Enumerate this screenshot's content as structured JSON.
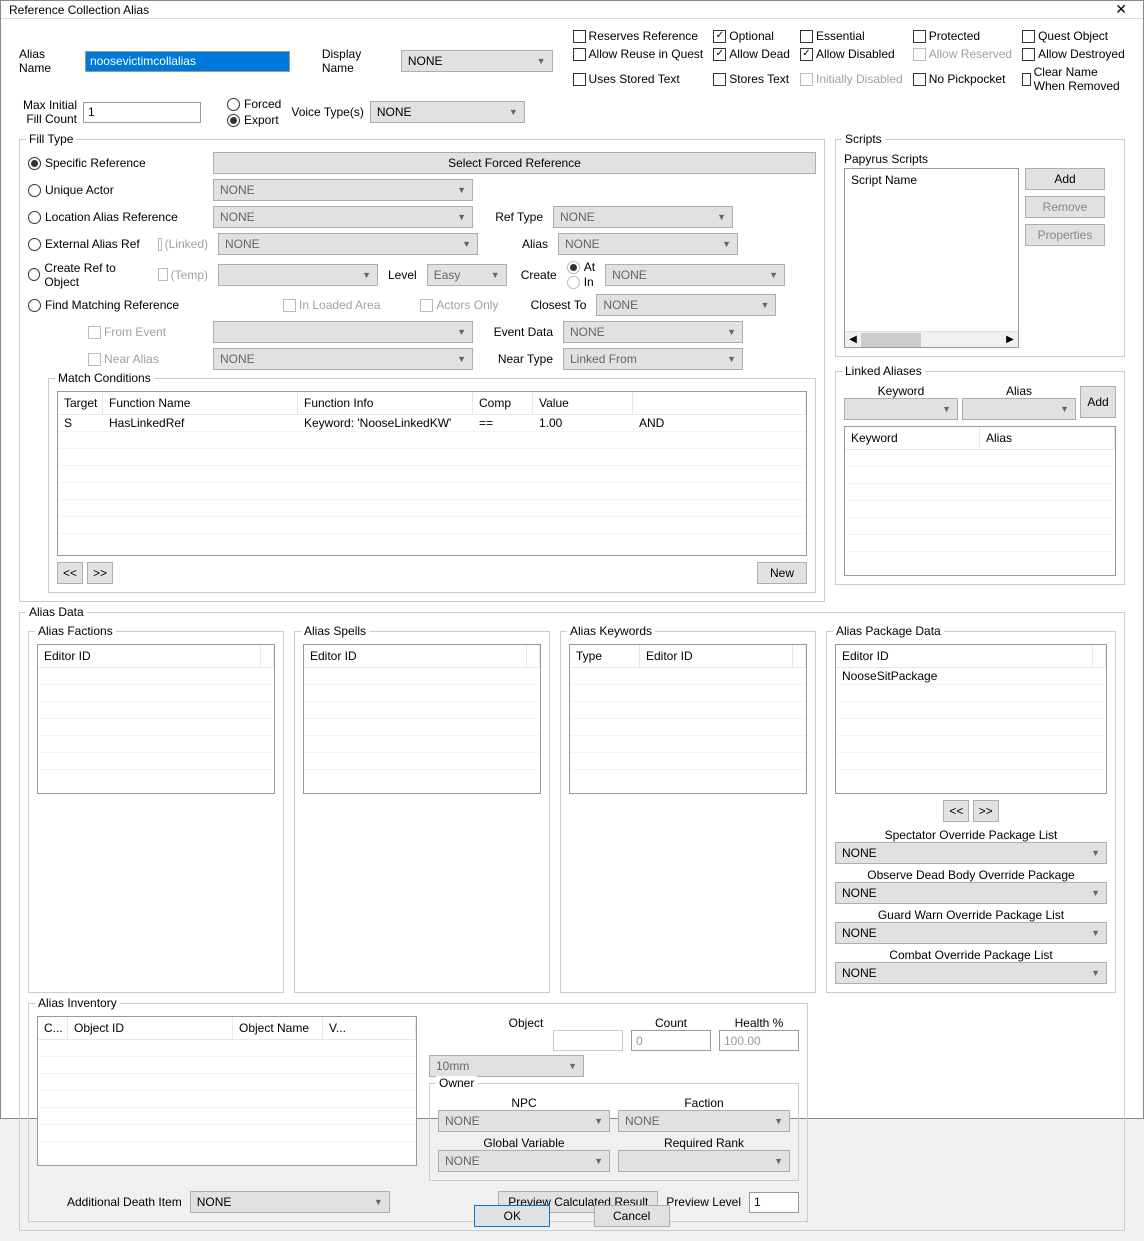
{
  "window": {
    "title": "Reference Collection Alias"
  },
  "alias_name_label": "Alias Name",
  "alias_name_value": "noosevictimcollalias",
  "display_name_label": "Display Name",
  "display_name_value": "NONE",
  "max_initial_label": "Max Initial\nFill Count",
  "max_initial_value": "1",
  "forced_label": "Forced",
  "export_label": "Export",
  "voice_types_label": "Voice Type(s)",
  "voice_types_value": "NONE",
  "flags": {
    "reserves_reference": "Reserves Reference",
    "optional": "Optional",
    "essential": "Essential",
    "protected": "Protected",
    "quest_object": "Quest Object",
    "allow_reuse": "Allow Reuse in Quest",
    "allow_dead": "Allow Dead",
    "allow_disabled": "Allow Disabled",
    "allow_reserved": "Allow Reserved",
    "allow_destroyed": "Allow Destroyed",
    "uses_stored_text": "Uses Stored Text",
    "stores_text": "Stores Text",
    "initially_disabled": "Initially Disabled",
    "no_pickpocket": "No Pickpocket",
    "clear_name": "Clear Name When Removed"
  },
  "fill_type": {
    "legend": "Fill Type",
    "specific_reference": "Specific Reference",
    "select_forced_btn": "Select Forced Reference",
    "unique_actor": "Unique Actor",
    "none": "NONE",
    "location_alias_ref": "Location Alias Reference",
    "ref_type_label": "Ref Type",
    "external_alias_ref": "External Alias Ref",
    "linked_label": "(Linked)",
    "alias_label": "Alias",
    "create_ref": "Create Ref to Object",
    "temp_label": "(Temp)",
    "level_label": "Level",
    "level_value": "Easy",
    "create_label": "Create",
    "create_at": "At",
    "create_in": "In",
    "find_matching": "Find Matching Reference",
    "in_loaded_area": "In Loaded Area",
    "actors_only": "Actors Only",
    "closest_to": "Closest To",
    "from_event": "From Event",
    "event_data": "Event Data",
    "near_alias": "Near Alias",
    "near_type": "Near Type",
    "near_type_value": "Linked From"
  },
  "match_conditions": {
    "legend": "Match Conditions",
    "headers": {
      "target": "Target",
      "function_name": "Function Name",
      "function_info": "Function Info",
      "comp": "Comp",
      "value": "Value",
      "logic": ""
    },
    "rows": [
      {
        "target": "S",
        "function_name": "HasLinkedRef",
        "function_info": "Keyword: 'NooseLinkedKW'",
        "comp": "==",
        "value": "1.00",
        "logic": "AND"
      }
    ],
    "prev": "<<",
    "next": ">>",
    "new": "New"
  },
  "scripts": {
    "legend": "Scripts",
    "papyrus": "Papyrus Scripts",
    "header": "Script Name",
    "add": "Add",
    "remove": "Remove",
    "properties": "Properties"
  },
  "linked_aliases": {
    "legend": "Linked Aliases",
    "keyword": "Keyword",
    "alias": "Alias",
    "add": "Add"
  },
  "alias_data": {
    "legend": "Alias Data",
    "factions": {
      "legend": "Alias Factions",
      "header": "Editor ID"
    },
    "spells": {
      "legend": "Alias Spells",
      "header": "Editor ID"
    },
    "keywords": {
      "legend": "Alias Keywords",
      "type": "Type",
      "editor_id": "Editor ID"
    }
  },
  "package_data": {
    "legend": "Alias Package Data",
    "header": "Editor ID",
    "row1": "NooseSitPackage",
    "prev": "<<",
    "next": ">>",
    "spectator": "Spectator Override Package List",
    "observe": "Observe Dead Body Override Package",
    "guard": "Guard Warn Override Package List",
    "combat": "Combat Override Package List",
    "none": "NONE"
  },
  "inventory": {
    "legend": "Alias Inventory",
    "c": "C...",
    "object_id": "Object ID",
    "object_name": "Object Name",
    "v": "V...",
    "object_label": "Object",
    "combo_value": "10mm",
    "count_label": "Count",
    "count_value": "0",
    "health_label": "Health %",
    "health_value": "100.00",
    "owner_legend": "Owner",
    "npc_label": "NPC",
    "faction_label": "Faction",
    "global_var": "Global Variable",
    "required_rank": "Required Rank",
    "none": "NONE",
    "additional_death": "Additional Death Item",
    "preview_btn": "Preview Calculated Result",
    "preview_level": "Preview Level",
    "preview_level_value": "1"
  },
  "buttons": {
    "ok": "OK",
    "cancel": "Cancel"
  }
}
